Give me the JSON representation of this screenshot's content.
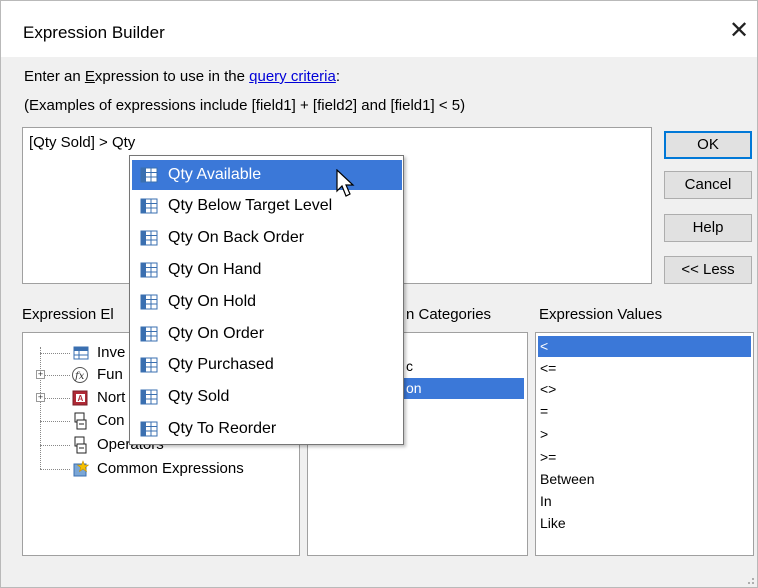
{
  "window": {
    "title": "Expression Builder",
    "close_glyph": "✕"
  },
  "instructions": {
    "line1_prefix": "Enter an ",
    "line1_underlined": "E",
    "line1_mid": "xpression to use in the ",
    "line1_link": "query criteria",
    "line1_suffix": ":",
    "line2": "(Examples of expressions include [field1] + [field2] and [field1] < 5)"
  },
  "expression": {
    "value": "[Qty Sold] > Qty"
  },
  "buttons": {
    "ok": "OK",
    "cancel": "Cancel",
    "help": "Help",
    "less": "<< Less"
  },
  "panels": {
    "elements_label": "Expression El",
    "categories_label": "n Categories",
    "values_label": "Expression Values"
  },
  "elements_tree": [
    {
      "label": "Inve",
      "icon": "table-icon"
    },
    {
      "label": "Fun",
      "icon": "function-icon"
    },
    {
      "label": "Nort",
      "icon": "database-icon"
    },
    {
      "label": "Con",
      "icon": "constants-icon"
    },
    {
      "label": "Operators",
      "icon": "operators-icon"
    },
    {
      "label": "Common Expressions",
      "icon": "common-expressions-icon"
    }
  ],
  "categories_fragments": [
    {
      "label": "c",
      "selected": false
    },
    {
      "label": "on",
      "selected": true
    }
  ],
  "expression_values": [
    {
      "label": "<",
      "selected": true
    },
    {
      "label": "<=",
      "selected": false
    },
    {
      "label": "<>",
      "selected": false
    },
    {
      "label": "=",
      "selected": false
    },
    {
      "label": ">",
      "selected": false
    },
    {
      "label": ">=",
      "selected": false
    },
    {
      "label": "Between",
      "selected": false
    },
    {
      "label": "In",
      "selected": false
    },
    {
      "label": "Like",
      "selected": false
    }
  ],
  "autocomplete": [
    {
      "label": "Qty Available",
      "selected": true
    },
    {
      "label": "Qty Below Target Level",
      "selected": false
    },
    {
      "label": "Qty On Back Order",
      "selected": false
    },
    {
      "label": "Qty On Hand",
      "selected": false
    },
    {
      "label": "Qty On Hold",
      "selected": false
    },
    {
      "label": "Qty On Order",
      "selected": false
    },
    {
      "label": "Qty Purchased",
      "selected": false
    },
    {
      "label": "Qty Sold",
      "selected": false
    },
    {
      "label": "Qty To Reorder",
      "selected": false
    }
  ],
  "colors": {
    "selection": "#3b78d8",
    "link": "#0000d8",
    "focus_border": "#0078d7"
  }
}
